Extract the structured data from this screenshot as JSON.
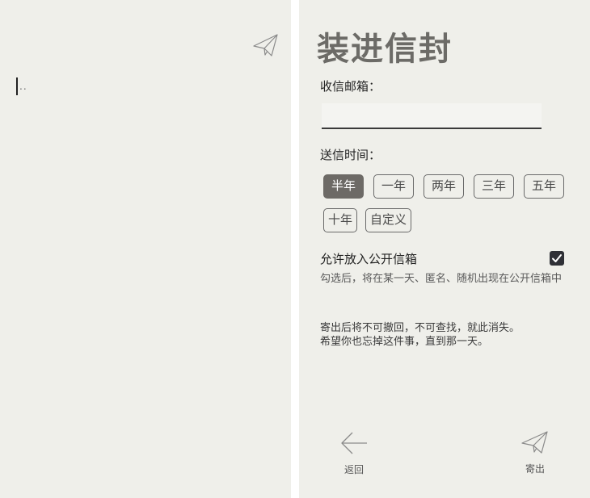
{
  "compose": {
    "placeholder": "..",
    "send_icon": "paper-plane-icon"
  },
  "envelope": {
    "title": "装进信封",
    "email_label": "收信邮箱：",
    "email_value": "",
    "time_label": "送信时间：",
    "durations": [
      {
        "label": "半年",
        "selected": true
      },
      {
        "label": "一年",
        "selected": false
      },
      {
        "label": "两年",
        "selected": false
      },
      {
        "label": "三年",
        "selected": false
      },
      {
        "label": "五年",
        "selected": false
      },
      {
        "label": "十年",
        "selected": false
      },
      {
        "label": "自定义",
        "selected": false
      }
    ],
    "public_label": "允许放入公开信箱",
    "public_checked": true,
    "public_hint": "勾选后，将在某一天、匿名、随机出现在公开信箱中",
    "warning_line1": "寄出后将不可撤回，不可查找，就此消失。",
    "warning_line2": "希望你也忘掉这件事，直到那一天。",
    "back_label": "返回",
    "back_icon": "arrow-left-icon",
    "send_label": "寄出",
    "send_icon": "paper-plane-icon"
  },
  "colors": {
    "paper": "#efefea",
    "selected_chip": "#6d6a66",
    "checkbox": "#2f3036",
    "title": "#6c6b67"
  }
}
